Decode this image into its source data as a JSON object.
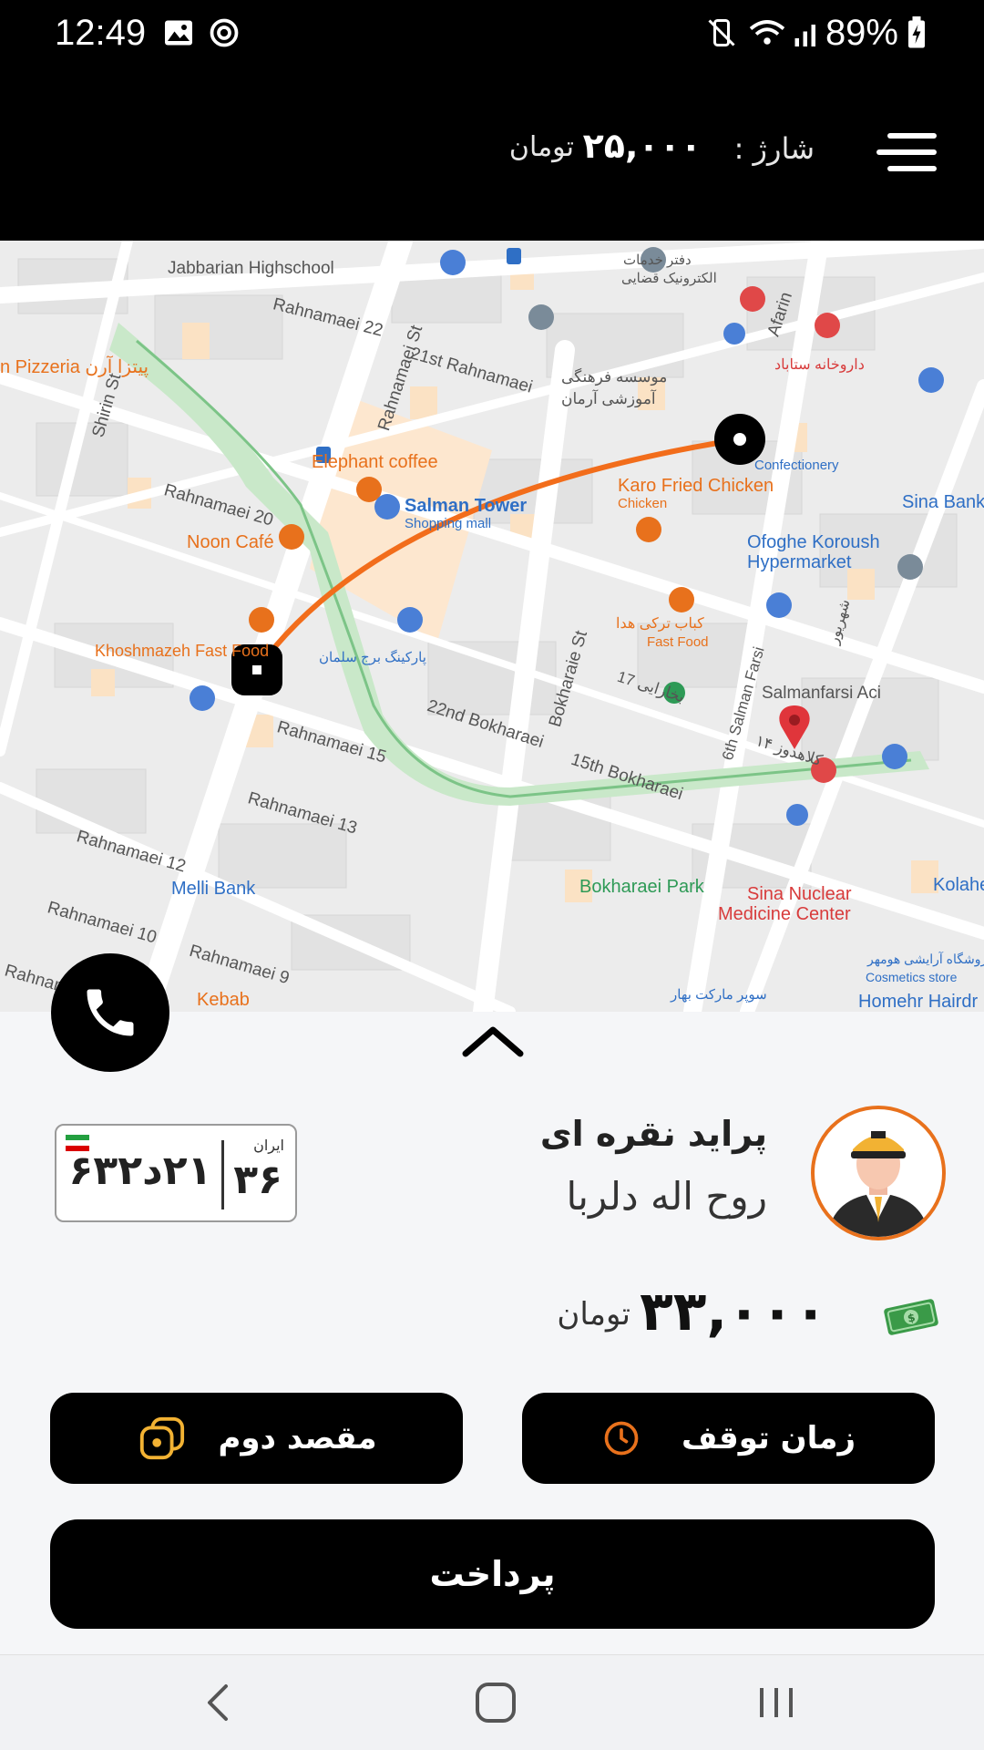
{
  "status_bar": {
    "time": "12:49",
    "battery": "89%",
    "icons": [
      "image-icon",
      "sync-icon",
      "vibrate-mute-icon",
      "wifi-icon",
      "signal-icon",
      "battery-charging-icon"
    ]
  },
  "header": {
    "charge_label": "شارژ :",
    "charge_amount": "۲۵,۰۰۰",
    "charge_unit": "تومان",
    "menu_icon": "hamburger-menu-icon"
  },
  "map": {
    "labels": {
      "jabbarian": "Jabbarian Highschool",
      "rahnamaei22": "Rahnamaei 22",
      "rahnamaei_st": "Rahnamaei St",
      "rahnamaei21": "21st Rahnamaei",
      "pizzeria": "n Pizzeria پیتزا آرن",
      "shirin_st": "Shirin St",
      "elephant": "Elephant coffee",
      "salman_tower": "Salman Tower",
      "shopping_mall": "Shopping mall",
      "rahnamaei20": "Rahnamaei 20",
      "noon_cafe": "Noon Café",
      "karo": "Karo Fried Chicken",
      "chicken": "Chicken",
      "ofoghe": "Ofoghe Koroush",
      "hypermarket": "Hypermarket",
      "sina_bank": "Sina Bank",
      "confectionery": "Confectionery",
      "afarin": "Afarin",
      "darokhaneh": "داروخانه ستاباد",
      "moassese": "موسسه فرهنگی",
      "amoozeshi": "آموزشی آرمان",
      "daftar": "دفتر خدمات",
      "electronic": "الکترونیک قضایی",
      "khoshmazeh": "Khoshmazeh Fast Food",
      "parking": "پارکینگ برج سلمان",
      "kebab_turki": "کباب ترکی هدا",
      "fast_food": "Fast Food",
      "salmanfarsi": "Salmanfarsi Aci",
      "bokharaie_st": "Bokharaie St",
      "bokharaei22": "22nd Bokharaei",
      "bokharaei17": "17 بخارایی",
      "salman_farsi6": "6th Salman Farsi",
      "kolahdooz": "کلاهدوز ۱۴",
      "bokharaei15": "15th Bokharaei",
      "rahnamaei15": "Rahnamaei 15",
      "rahnamaei13": "Rahnamaei 13",
      "rahnamaei12": "Rahnamaei 12",
      "rahnamaei10": "Rahnamaei 10",
      "rahnamaei9": "Rahnamaei 9",
      "melli_bank": "Melli Bank",
      "bokharaei_park": "Bokharaei Park",
      "sina_nuclear": "Sina Nuclear",
      "medicine_center": "Medicine Center",
      "kolahe": "Kolahe",
      "shahrivar": "شهریور",
      "cosmetics_fa": "فروشگاه آرایشی هومهر",
      "cosmetics": "Cosmetics store",
      "homehr": "Homehr Hairdr",
      "bahar": "سوپر مارکت بهار",
      "kebab": "Kebab",
      "rahnam": "Rahnam"
    }
  },
  "ride": {
    "car_name": "پراید نقره ای",
    "driver_name": "روح اله دلربا",
    "plate": {
      "country": "ایران",
      "region": "۳۶",
      "number": "۲۱د۶۳۲"
    },
    "fare_amount": "۳۳,۰۰۰",
    "fare_unit": "تومان",
    "fare_icon": "money-bill-icon"
  },
  "actions": {
    "stop_time": "زمان توقف",
    "second_destination": "مقصد دوم",
    "pay": "پرداخت"
  },
  "colors": {
    "accent": "#e8711c",
    "route": "#f26d1b",
    "dark": "#000000"
  }
}
